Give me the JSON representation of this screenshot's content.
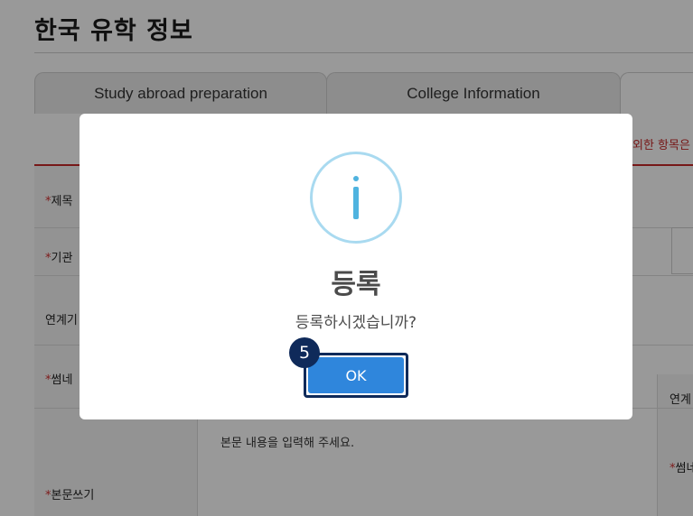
{
  "page": {
    "title": "한국 유학 정보",
    "tabs": [
      {
        "label": "Study abroad preparation"
      },
      {
        "label": "College Information"
      },
      {
        "label": ""
      }
    ],
    "notice_fragment": "외한 항목은",
    "form": {
      "required_mark": "*",
      "labels": {
        "subject": "제목",
        "institution": "기관",
        "link": "연계기",
        "thumbnail": "썸네",
        "body": "본문쓰기"
      },
      "right_labels": {
        "link": "연계",
        "thumbnail": "썸네"
      },
      "body_placeholder": "본문 내용을 입력해 주세요."
    }
  },
  "dialog": {
    "icon": "info-icon",
    "title": "등록",
    "message": "등록하시겠습니까?",
    "ok_label": "OK",
    "step_badge": "5"
  },
  "colors": {
    "accent_red": "#c62828",
    "ok_blue": "#2f86dc",
    "badge_navy": "#0f2a5a",
    "info_blue": "#4fb3df"
  }
}
